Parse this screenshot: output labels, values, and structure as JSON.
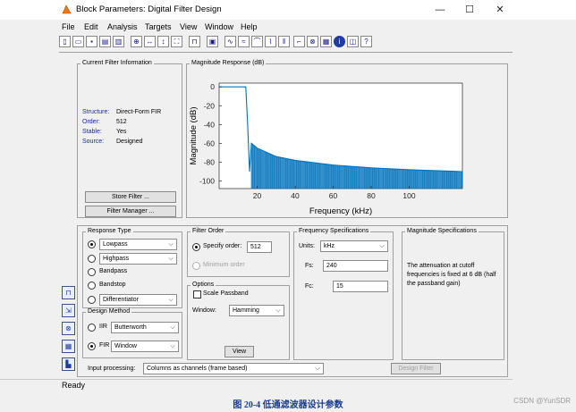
{
  "window": {
    "title": "Block Parameters: Digital Filter Design",
    "minimize": "—",
    "maximize": "☐",
    "close": "✕"
  },
  "menu": [
    "File",
    "Edit",
    "Analysis",
    "Targets",
    "View",
    "Window",
    "Help"
  ],
  "toolbar_icons": [
    "new-icon",
    "open-icon",
    "save-icon",
    "print-icon",
    "print-preview-icon",
    "zoom-in-icon",
    "zoom-x-icon",
    "zoom-y-icon",
    "full-view-icon",
    "filter-specs-icon",
    "magnitude-response-icon",
    "phase-response-icon",
    "magnitude-phase-icon",
    "group-delay-icon",
    "phase-delay-icon",
    "impulse-response-icon",
    "step-response-icon",
    "pole-zero-icon",
    "coefficients-icon",
    "info-icon",
    "round-off-icon",
    "help-icon"
  ],
  "current_filter": {
    "legend": "Current Filter Information",
    "rows": [
      {
        "label": "Structure:",
        "value": "Direct-Form FIR"
      },
      {
        "label": "Order:",
        "value": "512"
      },
      {
        "label": "Stable:",
        "value": "Yes"
      },
      {
        "label": "Source:",
        "value": "Designed"
      }
    ],
    "store_filter": "Store Filter ...",
    "filter_manager": "Filter Manager ..."
  },
  "plot": {
    "legend": "Magnitude Response (dB)",
    "colors": {
      "line": "#0072bd"
    }
  },
  "chart_data": {
    "type": "line",
    "xlabel": "Frequency (kHz)",
    "ylabel": "Magnitude (dB)",
    "xlim": [
      0,
      128
    ],
    "ylim": [
      -108,
      4
    ],
    "xticks": [
      20,
      40,
      60,
      80,
      100
    ],
    "yticks": [
      0,
      -20,
      -40,
      -60,
      -80,
      -100
    ],
    "grid": false,
    "series": [
      {
        "x": [
          0,
          14,
          15,
          16,
          17,
          20,
          30,
          40,
          60,
          80,
          100,
          128
        ],
        "y": [
          0,
          0,
          -40,
          -90,
          -60,
          -65,
          -74,
          -78,
          -83,
          -86,
          -88,
          -90
        ]
      }
    ],
    "sidelobe_floor_db": -108
  },
  "response_type": {
    "legend": "Response Type",
    "options": [
      {
        "label": "Lowpass",
        "selected": true,
        "has_dropdown": true
      },
      {
        "label": "Highpass",
        "selected": false,
        "has_dropdown": true
      },
      {
        "label": "Bandpass",
        "selected": false,
        "has_dropdown": false
      },
      {
        "label": "Bandstop",
        "selected": false,
        "has_dropdown": false
      },
      {
        "label": "Differentiator",
        "selected": false,
        "has_dropdown": true
      }
    ]
  },
  "design_method": {
    "legend": "Design Method",
    "iir_label": "IIR",
    "iir_value": "Butterworth",
    "fir_label": "FIR",
    "fir_value": "Window"
  },
  "filter_order": {
    "legend": "Filter Order",
    "specify_label": "Specify order:",
    "specify_value": "512",
    "minimum_label": "Minimum order"
  },
  "options": {
    "legend": "Options",
    "scale_passband": "Scale Passband",
    "window_label": "Window:",
    "window_value": "Hamming",
    "view_button": "View"
  },
  "freq_specs": {
    "legend": "Frequency Specifications",
    "units_label": "Units:",
    "units_value": "kHz",
    "fs_label": "Fs:",
    "fs_value": "240",
    "fc_label": "Fc:",
    "fc_value": "15"
  },
  "mag_specs": {
    "legend": "Magnitude Specifications",
    "text": "The attenuation at cutoff frequencies is fixed at 6 dB (half the passband gain)"
  },
  "input_processing": {
    "label": "Input processing:",
    "value": "Columns as channels (frame based)"
  },
  "design_filter": "Design Filter",
  "status": "Ready",
  "caption": "图 20-4 低通滤波器设计参数",
  "watermark": "CSDN @YunSDR"
}
